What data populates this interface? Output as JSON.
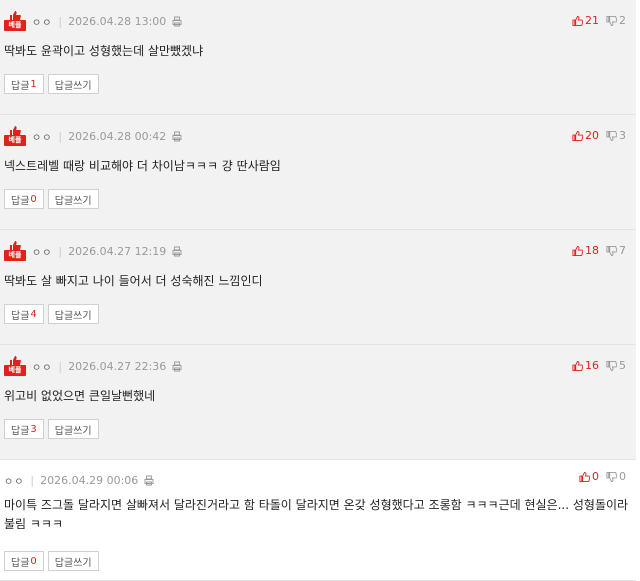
{
  "labels": {
    "best": "베플",
    "reply": "답글",
    "write_reply": "답글쓰기"
  },
  "colors": {
    "accent": "#e2211c",
    "best_bg": "#f2f2f2"
  },
  "comments": [
    {
      "best": true,
      "nick": "ㅇㅇ",
      "date": "2026.04.28 13:00",
      "text": "딱봐도 윤곽이고 성형했는데 살만뺐겠냐",
      "up": "21",
      "down": "2",
      "reply_count": "1"
    },
    {
      "best": true,
      "nick": "ㅇㅇ",
      "date": "2026.04.28 00:42",
      "text": "넥스트레벨 때랑 비교해야 더 차이남ㅋㅋㅋ 걍 딴사람임",
      "up": "20",
      "down": "3",
      "reply_count": "0"
    },
    {
      "best": true,
      "nick": "ㅇㅇ",
      "date": "2026.04.27 12:19",
      "text": "딱봐도 살 빠지고 나이 들어서 더 성숙해진 느낌인디",
      "up": "18",
      "down": "7",
      "reply_count": "4"
    },
    {
      "best": true,
      "nick": "ㅇㅇ",
      "date": "2026.04.27 22:36",
      "text": "위고비 없었으면 큰일날뻔했네",
      "up": "16",
      "down": "5",
      "reply_count": "3"
    },
    {
      "best": false,
      "nick": "ㅇㅇ",
      "date": "2026.04.29 00:06",
      "text": "마이특 즈그돌 달라지면 살빠져서 달라진거라고 함 타돌이 달라지면 온갖 성형했다고 조롱함 ㅋㅋㅋ근데 현실은... 성형돌이라 불림 ㅋㅋㅋ",
      "up": "0",
      "down": "0",
      "reply_count": "0"
    }
  ]
}
